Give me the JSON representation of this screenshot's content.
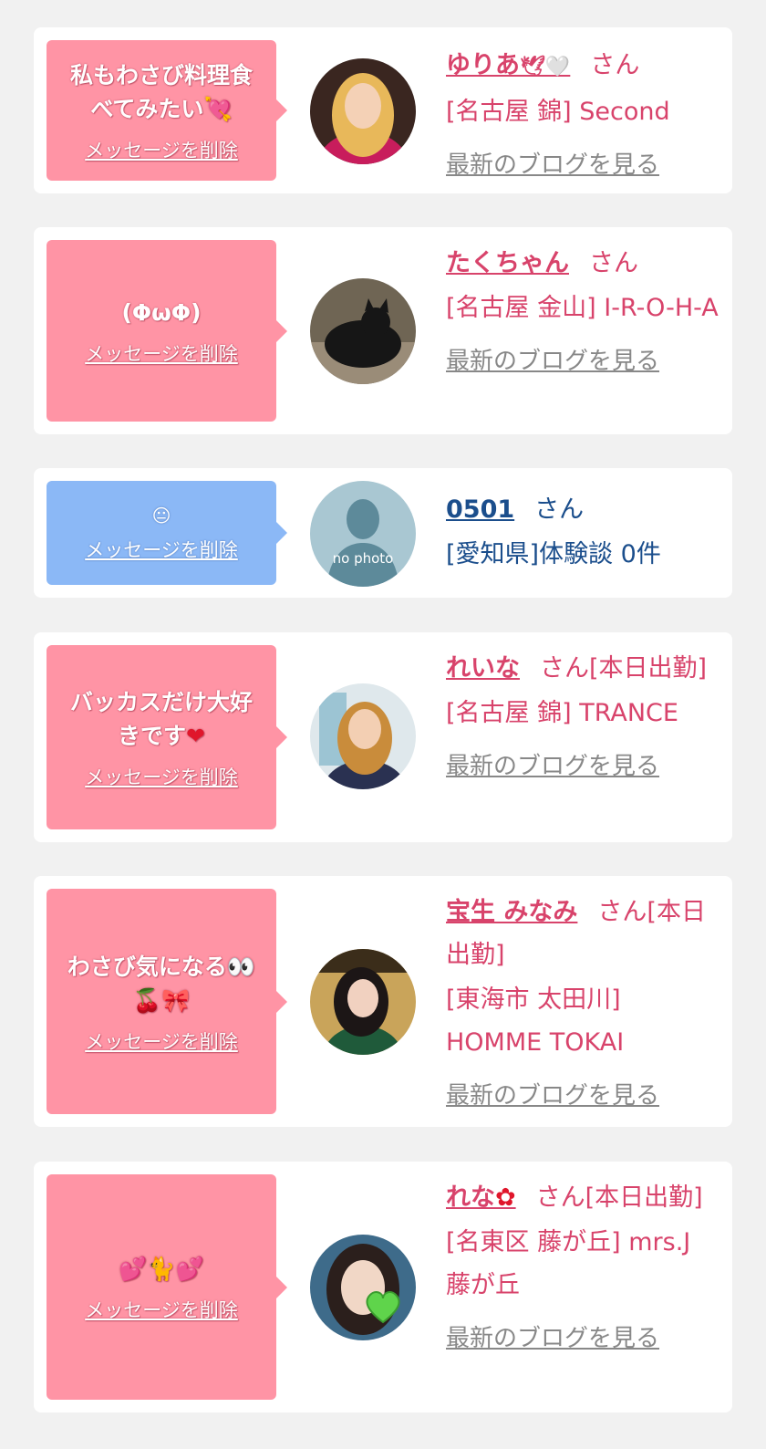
{
  "delete_label": "メッセージを削除",
  "blog_label": "最新のブログを見る",
  "honorific": "さん",
  "items": [
    {
      "message_line1": "私もわさび料理食",
      "message_line2": "べてみたい",
      "message_emoji": "💘",
      "name": "ゆりあ",
      "name_emoji": "🕊🤍",
      "status": "",
      "shop": "[名古屋 錦] Second",
      "has_blog": true,
      "avatar_icon": "avatar-photo"
    },
    {
      "message_line1": "(ΦωΦ)",
      "name": "たくちゃん",
      "status": "",
      "shop": "[名古屋 金山] I-R-O-H-A",
      "has_blog": true,
      "avatar_icon": "black-cat-photo"
    },
    {
      "message_line1": "😐",
      "name": "0501",
      "status": "",
      "shop": "[愛知県]体験談 0件",
      "has_blog": false,
      "avatar_text": "no photo",
      "avatar_icon": "no-photo-silhouette"
    },
    {
      "message_line1": "バッカスだけ大好",
      "message_line2": "きです",
      "message_emoji": "❤",
      "name": "れいな",
      "status": "[本日出勤]",
      "shop": "[名古屋 錦] TRANCE",
      "has_blog": true,
      "avatar_icon": "avatar-photo"
    },
    {
      "message_line1": "わさび気になる👀",
      "message_line2": "🍒🎀",
      "name": "宝生 みなみ",
      "status": "[本日出勤]",
      "shop": "[東海市 太田川] HOMME TOKAI",
      "has_blog": true,
      "avatar_icon": "avatar-photo"
    },
    {
      "message_line1": "💕🐈💕",
      "name": "れな",
      "name_emoji": "✿",
      "status": "[本日出勤]",
      "shop": "[名東区 藤が丘] mrs.J 藤が丘",
      "has_blog": true,
      "avatar_icon": "avatar-photo-green-heart"
    }
  ],
  "colors": {
    "pink_bubble": "#ff94a5",
    "blue_bubble": "#8bb8f6",
    "pink_text": "#d8436b",
    "blue_text": "#1b4e8c",
    "background": "#f1f1f1"
  }
}
